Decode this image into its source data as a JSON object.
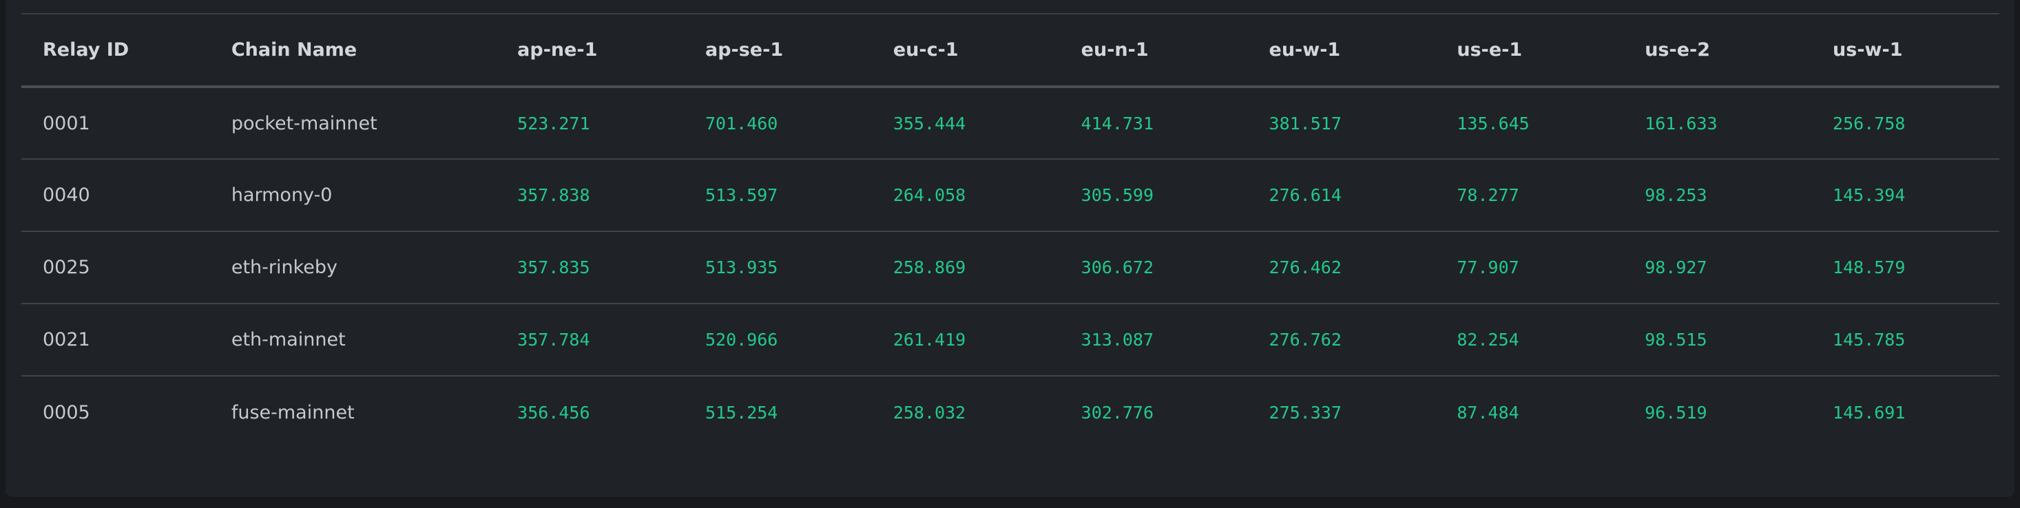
{
  "table": {
    "headers": [
      "Relay ID",
      "Chain Name",
      "ap-ne-1",
      "ap-se-1",
      "eu-c-1",
      "eu-n-1",
      "eu-w-1",
      "us-e-1",
      "us-e-2",
      "us-w-1"
    ],
    "rows": [
      [
        "0001",
        "pocket-mainnet",
        "523.271",
        "701.460",
        "355.444",
        "414.731",
        "381.517",
        "135.645",
        "161.633",
        "256.758"
      ],
      [
        "0040",
        "harmony-0",
        "357.838",
        "513.597",
        "264.058",
        "305.599",
        "276.614",
        "78.277",
        "98.253",
        "145.394"
      ],
      [
        "0025",
        "eth-rinkeby",
        "357.835",
        "513.935",
        "258.869",
        "306.672",
        "276.462",
        "77.907",
        "98.927",
        "148.579"
      ],
      [
        "0021",
        "eth-mainnet",
        "357.784",
        "520.966",
        "261.419",
        "313.087",
        "276.762",
        "82.254",
        "98.515",
        "145.785"
      ],
      [
        "0005",
        "fuse-mainnet",
        "356.456",
        "515.254",
        "258.032",
        "302.776",
        "275.337",
        "87.484",
        "96.519",
        "145.691"
      ]
    ]
  },
  "colors": {
    "background": "#17191c",
    "panel": "#1f2226",
    "header_text": "#d3d6db",
    "body_text": "#c5c9cf",
    "latency_value": "#22c98c"
  }
}
